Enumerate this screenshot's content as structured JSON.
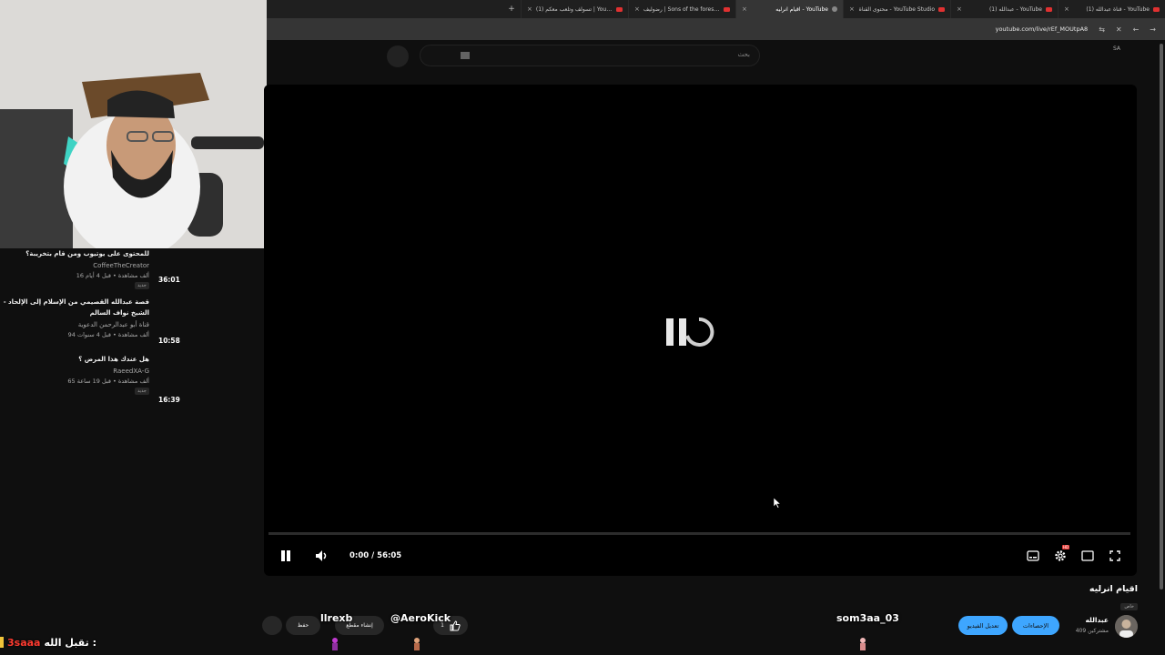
{
  "browser": {
    "tabs": [
      {
        "title": "(1) قناة عبدالله - YouTube",
        "active": false
      },
      {
        "title": "(1) عبدالله - YouTube",
        "active": false
      },
      {
        "title": "محتوى القناة - YouTube Studio",
        "active": false
      },
      {
        "title": "اقيام انرليه - YouTube",
        "active": true
      },
      {
        "title": "رضوليف | Sons of the forest (1)",
        "active": false
      },
      {
        "title": "(1) تسولف وتلعب معكم | YouTube",
        "active": false
      }
    ],
    "new_tab": "+",
    "close_glyph": "×",
    "url": "youtube.com/live/rEf_MOUtpA8"
  },
  "youtube": {
    "search_placeholder": "بحث",
    "account_initials": "SA"
  },
  "recommendations": [
    {
      "title": "للمحتوى على يوتيوب ومن قام بتخريبة؟",
      "channel": "CoffeeTheCreator",
      "meta": "16 ألف مشاهدة • قبل 4 أيام",
      "badge": "جديد",
      "duration": "36:01"
    },
    {
      "title": "قصة عبدالله القصيمي من الإسلام إلى الإلحاد - الشيخ نواف السالم",
      "channel": "قناة أبو عبدالرحمن الدعوية",
      "meta": "94 ألف مشاهدة • قبل 4 سنوات",
      "badge": "",
      "duration": "10:58"
    },
    {
      "title": "هل عندك هذا المرض ؟",
      "channel": "RaeedXA-G",
      "meta": "65 ألف مشاهدة • قبل 19 ساعة",
      "badge": "جديد",
      "duration": "16:39"
    }
  ],
  "player": {
    "time": "0:00 / 56:05",
    "progress": 0,
    "settings_badge": "HD"
  },
  "video": {
    "title": "اقيام انرليه",
    "visibility": "خاص",
    "channel_name": "عبدالله",
    "subscribers": "409 مشتركين",
    "stats_button": "الإحصاءات",
    "edit_button": "تعديل الفيديو",
    "like_count": "1",
    "create_clip": "إنشاء مقطع",
    "save": "حفظ"
  },
  "stream_overlay": {
    "names": [
      "llrexb",
      "@AeroKick",
      "som3aa_03"
    ],
    "chat_user": "3saaa",
    "chat_message": "تقبل الله :"
  },
  "colors": {
    "accent_blue": "#3ea6ff",
    "brand_red": "#ff0000",
    "chat_user_red": "#ff3b30"
  }
}
